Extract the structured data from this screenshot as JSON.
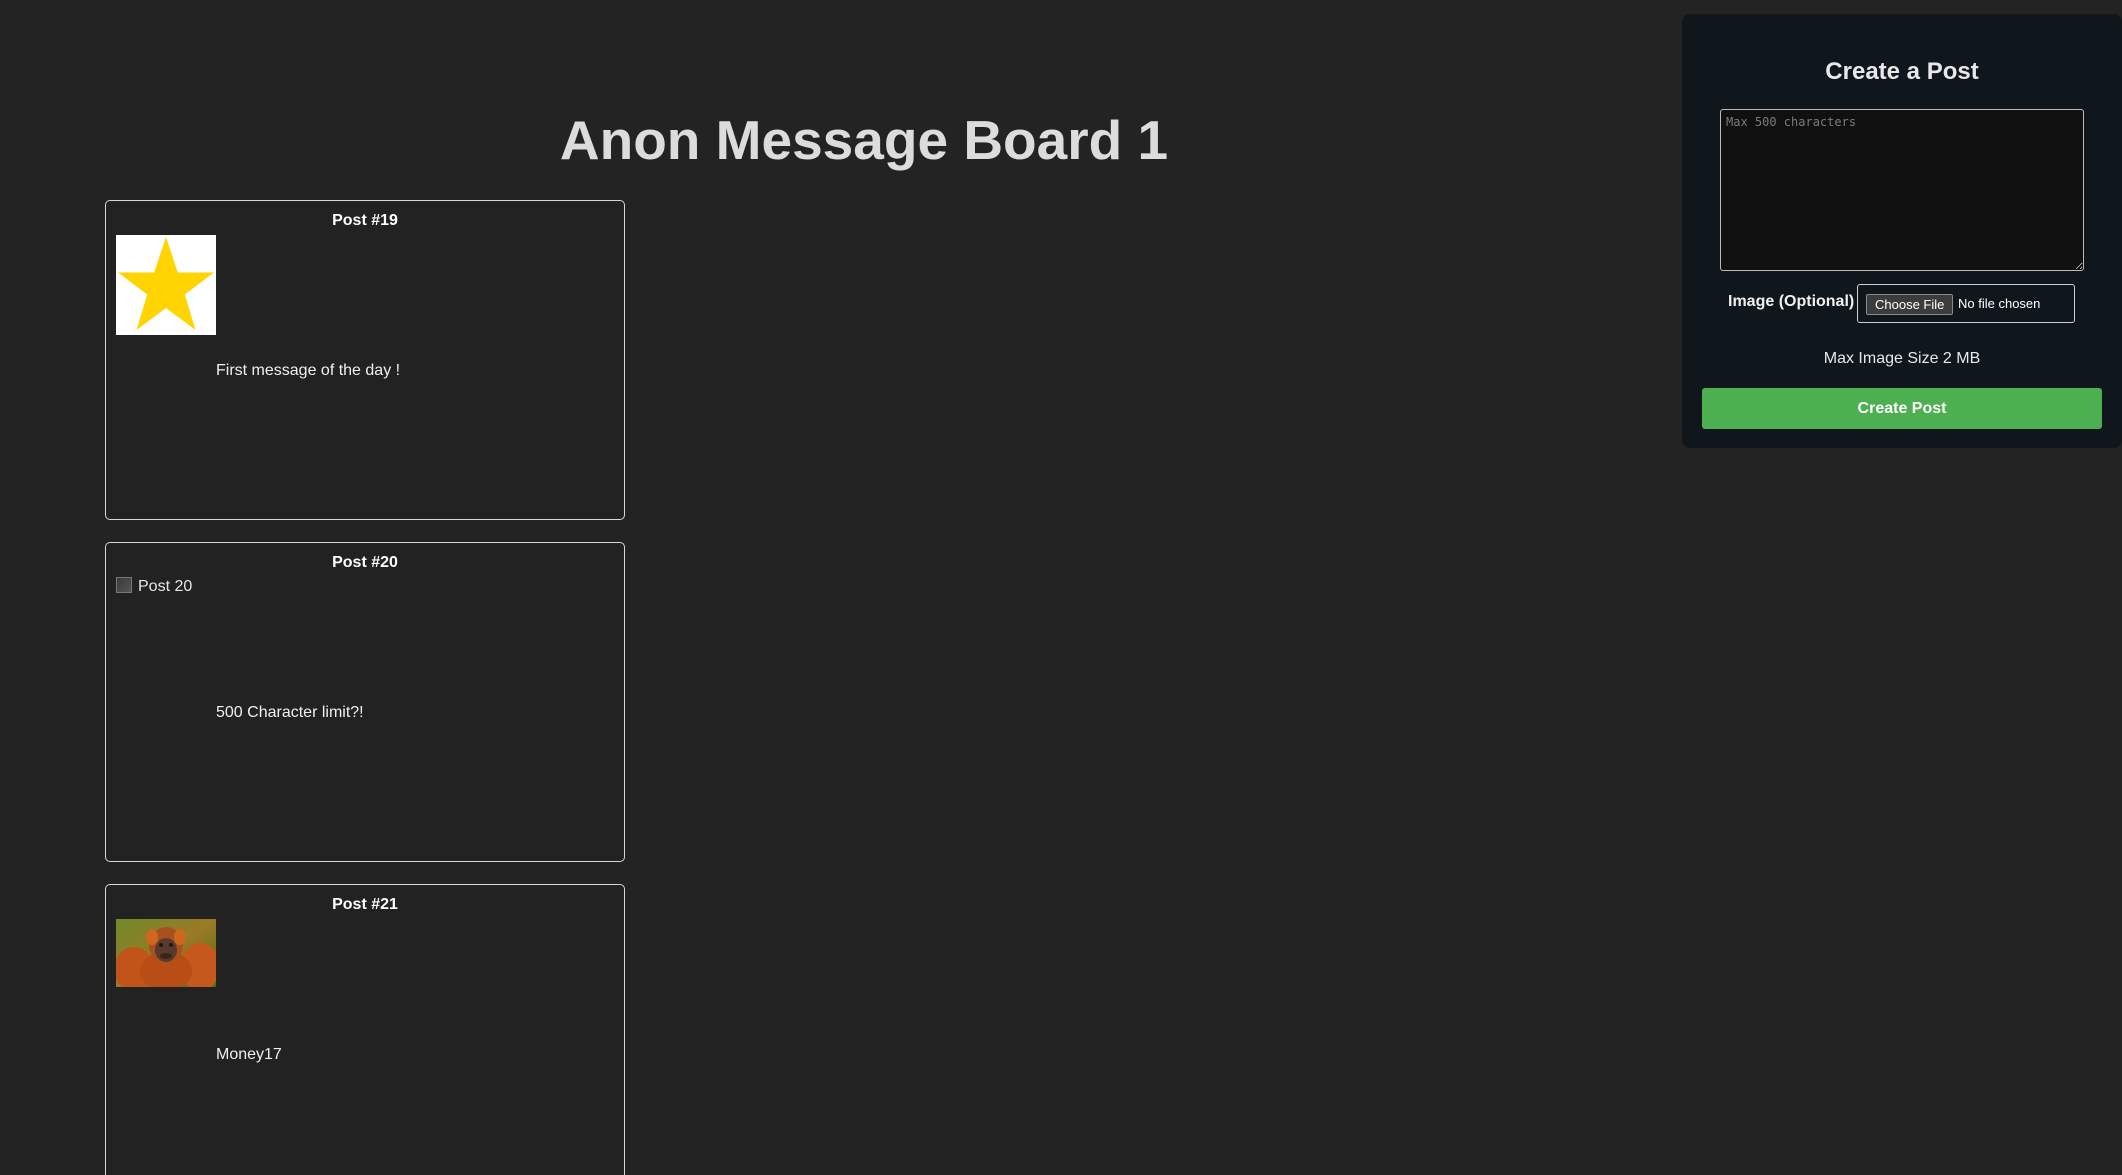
{
  "board": {
    "title": "Anon Message Board 1"
  },
  "posts": [
    {
      "title": "Post #19",
      "image": "star-image",
      "message": "First message of the day !"
    },
    {
      "title": "Post #20",
      "image_alt": "Post 20",
      "message": "500 Character limit?!"
    },
    {
      "title": "Post #21",
      "image": "orangutan-photo",
      "message": "Money17"
    }
  ],
  "create_post": {
    "title": "Create a Post",
    "textarea_placeholder": "Max 500 characters",
    "image_label": "Image (Optional)",
    "choose_file_label": "Choose File",
    "no_file_text": "No file chosen",
    "max_size_text": "Max Image Size 2 MB",
    "submit_label": "Create Post",
    "submit_color": "#4caf50"
  }
}
